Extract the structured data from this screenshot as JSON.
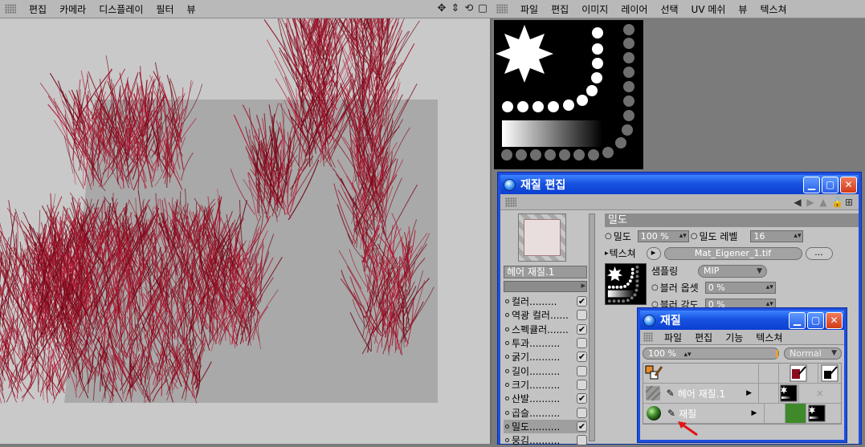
{
  "viewport": {
    "menu": [
      "편집",
      "카메라",
      "디스플레이",
      "필터",
      "뷰"
    ],
    "nav_icons": [
      "move-icon",
      "zoom-icon",
      "rotate-icon",
      "maximize-icon"
    ]
  },
  "uv_editor": {
    "menu": [
      "파일",
      "편집",
      "이미지",
      "레이어",
      "선택",
      "UV 메쉬",
      "뷰",
      "텍스쳐"
    ]
  },
  "material_editor": {
    "title": "재질 편집",
    "material_name": "헤어 재질.1",
    "channels": [
      {
        "label": "컬러.........",
        "checked": true
      },
      {
        "label": "역광 컬러......",
        "checked": false
      },
      {
        "label": "스펙큘러.......",
        "checked": true
      },
      {
        "label": "투과..........",
        "checked": false
      },
      {
        "label": "굵기..........",
        "checked": true
      },
      {
        "label": "길이..........",
        "checked": false
      },
      {
        "label": "크기..........",
        "checked": false
      },
      {
        "label": "산발..........",
        "checked": true
      },
      {
        "label": "곱슬..........",
        "checked": false
      },
      {
        "label": "밀도..........",
        "checked": true,
        "active": true
      },
      {
        "label": "뭉김..........",
        "checked": false
      }
    ],
    "section_title": "밀도",
    "density_label": "밀도",
    "density_value": "100 %",
    "density_level_label": "밀도 레벨",
    "density_level_value": "16",
    "texture_label": "텍스쳐",
    "texture_file": "Mat_Eigener_1.tif",
    "more_button": "...",
    "sampling_label": "샘플링",
    "sampling_value": "MIP",
    "blur_offset_label": "블러 옵셋",
    "blur_offset_value": "0 %",
    "blur_strength_label": "블러 강도",
    "blur_strength_value": "0 %"
  },
  "materials_window": {
    "title": "재질",
    "menu": [
      "파일",
      "편집",
      "기능",
      "텍스쳐"
    ],
    "zoom": "100 %",
    "blend_mode": "Normal",
    "rows": [
      {
        "name": ""
      },
      {
        "name": "헤어 재질.1"
      },
      {
        "name": "재질"
      }
    ]
  },
  "colors": {
    "hair": "#8b0b1e",
    "title_blue": "#1852e0",
    "material_green": "#3e8a2a"
  }
}
